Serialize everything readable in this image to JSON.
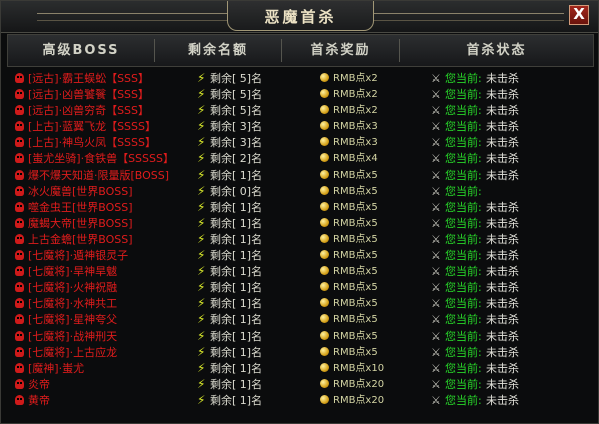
{
  "window": {
    "title": "恶魔首杀",
    "close_label": "X"
  },
  "header": {
    "columns": [
      "高级BOSS",
      "剩余名额",
      "首杀奖励",
      "首杀状态"
    ]
  },
  "colors": {
    "boss_name": "#e01c1c",
    "status_prefix": "#27d629",
    "reward": "#d4d5a4"
  },
  "icons": {
    "boss": "skull-icon",
    "remaining": "lightning-icon",
    "reward": "gold-coin-icon",
    "status": "crossed-swords-icon"
  },
  "rows": [
    {
      "boss": "[远古]·霸王蜈蚣【SSS】",
      "remaining": "剩余[ 5]名",
      "reward": "RMB点x2",
      "status_prefix": "您当前:",
      "status": "未击杀"
    },
    {
      "boss": "[远古]·凶兽饕餮【SSS】",
      "remaining": "剩余[ 5]名",
      "reward": "RMB点x2",
      "status_prefix": "您当前:",
      "status": "未击杀"
    },
    {
      "boss": "[远古]·凶兽穷奇【SSS】",
      "remaining": "剩余[ 5]名",
      "reward": "RMB点x2",
      "status_prefix": "您当前:",
      "status": "未击杀"
    },
    {
      "boss": "[上古]·蓝翼飞龙【SSSS】",
      "remaining": "剩余[ 3]名",
      "reward": "RMB点x3",
      "status_prefix": "您当前:",
      "status": "未击杀"
    },
    {
      "boss": "[上古]·神鸟火凤【SSSS】",
      "remaining": "剩余[ 3]名",
      "reward": "RMB点x3",
      "status_prefix": "您当前:",
      "status": "未击杀"
    },
    {
      "boss": "[蚩尤坐骑]·食铁兽【SSSSS】",
      "remaining": "剩余[ 2]名",
      "reward": "RMB点x4",
      "status_prefix": "您当前:",
      "status": "未击杀"
    },
    {
      "boss": "爆不爆天知道·限量版[BOSS]",
      "remaining": "剩余[ 1]名",
      "reward": "RMB点x5",
      "status_prefix": "您当前:",
      "status": "未击杀"
    },
    {
      "boss": "冰火魔兽[世界BOSS]",
      "remaining": "剩余[ 0]名",
      "reward": "RMB点x5",
      "status_prefix": "您当前:",
      "status": ""
    },
    {
      "boss": "噬金虫王[世界BOSS]",
      "remaining": "剩余[ 1]名",
      "reward": "RMB点x5",
      "status_prefix": "您当前:",
      "status": "未击杀"
    },
    {
      "boss": "魔蝎大帝[世界BOSS]",
      "remaining": "剩余[ 1]名",
      "reward": "RMB点x5",
      "status_prefix": "您当前:",
      "status": "未击杀"
    },
    {
      "boss": "上古金蟾[世界BOSS]",
      "remaining": "剩余[ 1]名",
      "reward": "RMB点x5",
      "status_prefix": "您当前:",
      "status": "未击杀"
    },
    {
      "boss": "[七魔将]·遁神银灵子",
      "remaining": "剩余[ 1]名",
      "reward": "RMB点x5",
      "status_prefix": "您当前:",
      "status": "未击杀"
    },
    {
      "boss": "[七魔将]·旱神旱魃",
      "remaining": "剩余[ 1]名",
      "reward": "RMB点x5",
      "status_prefix": "您当前:",
      "status": "未击杀"
    },
    {
      "boss": "[七魔将]·火神祝融",
      "remaining": "剩余[ 1]名",
      "reward": "RMB点x5",
      "status_prefix": "您当前:",
      "status": "未击杀"
    },
    {
      "boss": "[七魔将]·水神共工",
      "remaining": "剩余[ 1]名",
      "reward": "RMB点x5",
      "status_prefix": "您当前:",
      "status": "未击杀"
    },
    {
      "boss": "[七魔将]·星神夸父",
      "remaining": "剩余[ 1]名",
      "reward": "RMB点x5",
      "status_prefix": "您当前:",
      "status": "未击杀"
    },
    {
      "boss": "[七魔将]·战神刑天",
      "remaining": "剩余[ 1]名",
      "reward": "RMB点x5",
      "status_prefix": "您当前:",
      "status": "未击杀"
    },
    {
      "boss": "[七魔将]·上古应龙",
      "remaining": "剩余[ 1]名",
      "reward": "RMB点x5",
      "status_prefix": "您当前:",
      "status": "未击杀"
    },
    {
      "boss": "[魔神]·蚩尤",
      "remaining": "剩余[ 1]名",
      "reward": "RMB点x10",
      "status_prefix": "您当前:",
      "status": "未击杀"
    },
    {
      "boss": "炎帝",
      "remaining": "剩余[ 1]名",
      "reward": "RMB点x20",
      "status_prefix": "您当前:",
      "status": "未击杀"
    },
    {
      "boss": "黄帝",
      "remaining": "剩余[ 1]名",
      "reward": "RMB点x20",
      "status_prefix": "您当前:",
      "status": "未击杀"
    }
  ]
}
